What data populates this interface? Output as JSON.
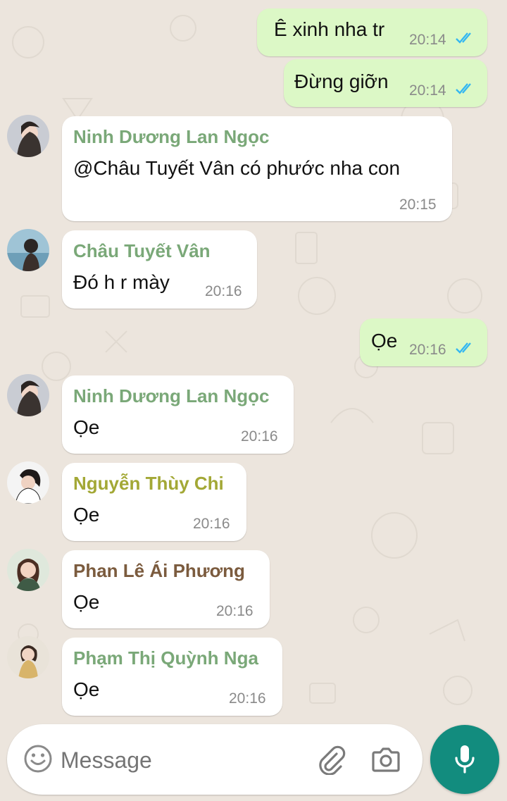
{
  "colors": {
    "background": "#ece5dd",
    "outgoing_bubble": "#dcf8c6",
    "incoming_bubble": "#ffffff",
    "read_ticks": "#34b7f1",
    "mic_button": "#128c7e"
  },
  "messages": [
    {
      "direction": "out",
      "text": "Ê xinh nha tr",
      "time": "20:14",
      "status": "read"
    },
    {
      "direction": "out",
      "text": "Đừng giỡn",
      "time": "20:14",
      "status": "read"
    },
    {
      "direction": "in",
      "sender": "Ninh Dương Lan Ngọc",
      "sender_color": "#7aa878",
      "text": "@Châu Tuyết Vân có phước nha con",
      "time": "20:15"
    },
    {
      "direction": "in",
      "sender": "Châu Tuyết Vân",
      "sender_color": "#7aa878",
      "text": "Đó h r mày",
      "time": "20:16"
    },
    {
      "direction": "out",
      "text": "Ọe",
      "time": "20:16",
      "status": "read"
    },
    {
      "direction": "in",
      "sender": "Ninh Dương Lan Ngọc",
      "sender_color": "#7aa878",
      "text": "Ọe",
      "time": "20:16"
    },
    {
      "direction": "in",
      "sender": "Nguyễn Thùy Chi",
      "sender_color": "#a3a836",
      "text": "Ọe",
      "time": "20:16"
    },
    {
      "direction": "in",
      "sender": "Phan Lê Ái Phương",
      "sender_color": "#7b5b3e",
      "text": "Ọe",
      "time": "20:16"
    },
    {
      "direction": "in",
      "sender": "Phạm Thị Quỳnh Nga",
      "sender_color": "#7aa878",
      "text": "Ọe",
      "time": "20:16"
    }
  ],
  "composer": {
    "placeholder": "Message",
    "emoji_icon": "emoji-icon",
    "attach_icon": "paperclip-icon",
    "camera_icon": "camera-icon",
    "mic_icon": "microphone-icon"
  }
}
